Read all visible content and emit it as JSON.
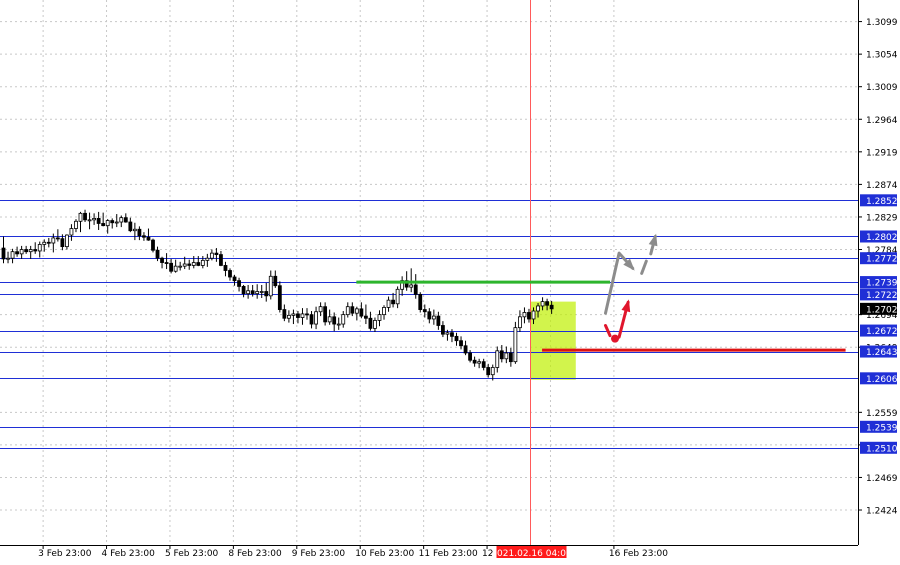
{
  "chart_data": {
    "type": "candlestick",
    "instrument_timeframe": "",
    "price_range": [
      1.2395,
      1.3115
    ],
    "x_categories": [
      "3 Feb 23:00",
      "4 Feb 23:00",
      "5 Feb 23:00",
      "8 Feb 23:00",
      "9 Feb 23:00",
      "10 Feb 23:00",
      "11 Feb 23:00",
      "12 Feb 23:00",
      "2021.02.16 04:00",
      "16 Feb 23:00"
    ],
    "x_bar_index": [
      4,
      18,
      32,
      46,
      60,
      74,
      88,
      102,
      116,
      130
    ],
    "y_ticks": [
      "1.3099",
      "1.3054",
      "1.3009",
      "1.2964",
      "1.2919",
      "1.2874",
      "1.2829",
      "1.2784",
      "1.2694",
      "1.2649",
      "1.2559",
      "1.2514",
      "1.2469",
      "1.2424"
    ],
    "y_tick_values": [
      1.3099,
      1.3054,
      1.3009,
      1.2964,
      1.2919,
      1.2874,
      1.2829,
      1.2784,
      1.2694,
      1.2649,
      1.2559,
      1.2514,
      1.2469,
      1.2424
    ],
    "current_price": "1.2702",
    "current_price_value": 1.2702,
    "levels": [
      {
        "label": "1.2852",
        "value": 1.2852
      },
      {
        "label": "1.2802",
        "value": 1.2802
      },
      {
        "label": "1.2772",
        "value": 1.2772
      },
      {
        "label": "1.2739",
        "value": 1.2739
      },
      {
        "label": "1.2722",
        "value": 1.2722
      },
      {
        "label": "1.2672",
        "value": 1.2672
      },
      {
        "label": "1.2643",
        "value": 1.2643
      },
      {
        "label": "1.2606",
        "value": 1.2606
      },
      {
        "label": "1.2539",
        "value": 1.2539
      },
      {
        "label": "1.2510",
        "value": 1.251
      }
    ],
    "vertical_marker": {
      "label": "2021.02.16 04:00",
      "bar_index": 116
    },
    "highlight_zone": {
      "bar_start": 116,
      "bar_end": 126,
      "price_low": 1.2604,
      "price_high": 1.2712,
      "color": "#bff000"
    },
    "green_level": {
      "value": 1.2739,
      "bar_start": 78,
      "bar_end": 134,
      "color": "#2db52d"
    },
    "red_level": {
      "value": 1.2645,
      "bar_start": 119,
      "bar_end": 186,
      "color": "#dd1111"
    },
    "projections": [
      {
        "color": "#8c8c8c",
        "points": [
          [
            133,
            1.2696
          ],
          [
            136,
            1.2779
          ],
          [
            139,
            1.2758
          ]
        ]
      },
      {
        "color": "#8c8c8c",
        "points": [
          [
            141,
            1.2751
          ],
          [
            142,
            1.2768
          ]
        ]
      },
      {
        "color": "#8c8c8c",
        "points": [
          [
            143,
            1.2778
          ],
          [
            144,
            1.2802
          ]
        ]
      },
      {
        "color": "#e0162c",
        "points": [
          [
            133,
            1.2679
          ],
          [
            134,
            1.2665
          ]
        ]
      },
      {
        "color": "#e0162c",
        "points": [
          [
            136,
            1.2663
          ],
          [
            138,
            1.2711
          ]
        ]
      }
    ],
    "candles": [
      [
        1.2786,
        1.2802,
        1.2765,
        1.2771
      ],
      [
        1.2771,
        1.2781,
        1.2765,
        1.2772
      ],
      [
        1.2772,
        1.2785,
        1.2765,
        1.2781
      ],
      [
        1.2781,
        1.2788,
        1.2774,
        1.2778
      ],
      [
        1.2778,
        1.2789,
        1.2771,
        1.2784
      ],
      [
        1.2784,
        1.2789,
        1.2778,
        1.2781
      ],
      [
        1.2781,
        1.2789,
        1.2771,
        1.2784
      ],
      [
        1.2784,
        1.2794,
        1.2778,
        1.2782
      ],
      [
        1.2782,
        1.2795,
        1.2773,
        1.2791
      ],
      [
        1.2791,
        1.2798,
        1.2781,
        1.2794
      ],
      [
        1.2794,
        1.28,
        1.2787,
        1.2793
      ],
      [
        1.2793,
        1.2806,
        1.278,
        1.28
      ],
      [
        1.28,
        1.2812,
        1.2795,
        1.2799
      ],
      [
        1.2799,
        1.2805,
        1.2783,
        1.2788
      ],
      [
        1.2788,
        1.2805,
        1.2784,
        1.2804
      ],
      [
        1.2804,
        1.2819,
        1.2796,
        1.2813
      ],
      [
        1.2813,
        1.2826,
        1.2808,
        1.2823
      ],
      [
        1.2823,
        1.2836,
        1.2808,
        1.2834
      ],
      [
        1.2834,
        1.2839,
        1.2822,
        1.2825
      ],
      [
        1.2825,
        1.2835,
        1.2812,
        1.2825
      ],
      [
        1.2825,
        1.2834,
        1.2818,
        1.2827
      ],
      [
        1.2827,
        1.2836,
        1.2811,
        1.282
      ],
      [
        1.282,
        1.2835,
        1.2816,
        1.2817
      ],
      [
        1.2817,
        1.2826,
        1.2806,
        1.2824
      ],
      [
        1.2824,
        1.2827,
        1.2813,
        1.2821
      ],
      [
        1.2821,
        1.2833,
        1.2815,
        1.2822
      ],
      [
        1.2822,
        1.2831,
        1.2815,
        1.2828
      ],
      [
        1.2828,
        1.2834,
        1.2821,
        1.2822
      ],
      [
        1.2822,
        1.2828,
        1.2808,
        1.281
      ],
      [
        1.281,
        1.2821,
        1.2797,
        1.2812
      ],
      [
        1.2812,
        1.2816,
        1.2797,
        1.2803
      ],
      [
        1.2803,
        1.2808,
        1.2796,
        1.2801
      ],
      [
        1.2801,
        1.2813,
        1.2796,
        1.2797
      ],
      [
        1.2797,
        1.2799,
        1.278,
        1.2783
      ],
      [
        1.2783,
        1.2788,
        1.2768,
        1.2772
      ],
      [
        1.2772,
        1.2774,
        1.2758,
        1.2766
      ],
      [
        1.2766,
        1.2779,
        1.2757,
        1.2765
      ],
      [
        1.2765,
        1.2771,
        1.2751,
        1.2754
      ],
      [
        1.2754,
        1.277,
        1.2752,
        1.2761
      ],
      [
        1.2761,
        1.2767,
        1.2755,
        1.2761
      ],
      [
        1.2761,
        1.2774,
        1.2757,
        1.2764
      ],
      [
        1.2764,
        1.277,
        1.2756,
        1.2762
      ],
      [
        1.2762,
        1.2775,
        1.2758,
        1.2766
      ],
      [
        1.2766,
        1.2775,
        1.2761,
        1.2762
      ],
      [
        1.2762,
        1.2775,
        1.2758,
        1.2769
      ],
      [
        1.2769,
        1.2778,
        1.276,
        1.2772
      ],
      [
        1.2772,
        1.2784,
        1.2769,
        1.2779
      ],
      [
        1.2779,
        1.2786,
        1.2767,
        1.2777
      ],
      [
        1.2777,
        1.2782,
        1.2761,
        1.2762
      ],
      [
        1.2762,
        1.2767,
        1.2747,
        1.2755
      ],
      [
        1.2755,
        1.2758,
        1.2741,
        1.2746
      ],
      [
        1.2746,
        1.2749,
        1.2734,
        1.2741
      ],
      [
        1.2741,
        1.2745,
        1.2726,
        1.2733
      ],
      [
        1.2733,
        1.2735,
        1.2718,
        1.2723
      ],
      [
        1.2723,
        1.2735,
        1.2716,
        1.2727
      ],
      [
        1.2727,
        1.2735,
        1.2719,
        1.2723
      ],
      [
        1.2723,
        1.2736,
        1.2716,
        1.2726
      ],
      [
        1.2726,
        1.2735,
        1.2717,
        1.2726
      ],
      [
        1.2726,
        1.2738,
        1.2712,
        1.272
      ],
      [
        1.272,
        1.2755,
        1.2715,
        1.2747
      ],
      [
        1.2747,
        1.2755,
        1.2731,
        1.2734
      ],
      [
        1.2734,
        1.274,
        1.2697,
        1.2701
      ],
      [
        1.2701,
        1.2708,
        1.2685,
        1.2689
      ],
      [
        1.2689,
        1.27,
        1.2683,
        1.2693
      ],
      [
        1.2693,
        1.2701,
        1.2681,
        1.2695
      ],
      [
        1.2695,
        1.2699,
        1.2682,
        1.269
      ],
      [
        1.269,
        1.2703,
        1.268,
        1.2695
      ],
      [
        1.2695,
        1.2703,
        1.2687,
        1.2694
      ],
      [
        1.2694,
        1.2699,
        1.2675,
        1.2681
      ],
      [
        1.2681,
        1.2705,
        1.2674,
        1.2698
      ],
      [
        1.2698,
        1.2711,
        1.2692,
        1.2705
      ],
      [
        1.2705,
        1.2711,
        1.2679,
        1.2684
      ],
      [
        1.2684,
        1.2701,
        1.268,
        1.2691
      ],
      [
        1.2691,
        1.2697,
        1.2671,
        1.2681
      ],
      [
        1.2681,
        1.269,
        1.2673,
        1.2681
      ],
      [
        1.2681,
        1.2699,
        1.2676,
        1.2694
      ],
      [
        1.2694,
        1.2711,
        1.269,
        1.2705
      ],
      [
        1.2705,
        1.2711,
        1.2692,
        1.2696
      ],
      [
        1.2696,
        1.2705,
        1.2686,
        1.2702
      ],
      [
        1.2702,
        1.2711,
        1.2689,
        1.2692
      ],
      [
        1.2692,
        1.2708,
        1.2681,
        1.2689
      ],
      [
        1.2689,
        1.2698,
        1.2672,
        1.2675
      ],
      [
        1.2675,
        1.269,
        1.267,
        1.2686
      ],
      [
        1.2686,
        1.27,
        1.2678,
        1.2694
      ],
      [
        1.2694,
        1.2707,
        1.2687,
        1.2704
      ],
      [
        1.2704,
        1.2719,
        1.2698,
        1.2714
      ],
      [
        1.2714,
        1.2724,
        1.2704,
        1.2709
      ],
      [
        1.2709,
        1.2733,
        1.2703,
        1.2729
      ],
      [
        1.2729,
        1.2747,
        1.272,
        1.2741
      ],
      [
        1.2741,
        1.2754,
        1.2727,
        1.2732
      ],
      [
        1.2732,
        1.2758,
        1.2725,
        1.2735
      ],
      [
        1.2735,
        1.275,
        1.2716,
        1.2722
      ],
      [
        1.2722,
        1.2725,
        1.2697,
        1.2701
      ],
      [
        1.2701,
        1.2708,
        1.269,
        1.2698
      ],
      [
        1.2698,
        1.2703,
        1.2682,
        1.2688
      ],
      [
        1.2688,
        1.2701,
        1.268,
        1.2692
      ],
      [
        1.2692,
        1.2698,
        1.2673,
        1.2679
      ],
      [
        1.2679,
        1.2685,
        1.2663,
        1.2667
      ],
      [
        1.2667,
        1.2673,
        1.2658,
        1.2669
      ],
      [
        1.2669,
        1.2674,
        1.2656,
        1.2664
      ],
      [
        1.2664,
        1.2669,
        1.2651,
        1.2658
      ],
      [
        1.2658,
        1.2664,
        1.2646,
        1.2651
      ],
      [
        1.2651,
        1.2658,
        1.2638,
        1.2641
      ],
      [
        1.2641,
        1.2645,
        1.2628,
        1.2631
      ],
      [
        1.2631,
        1.2636,
        1.2622,
        1.2627
      ],
      [
        1.2627,
        1.2633,
        1.262,
        1.2629
      ],
      [
        1.2629,
        1.2633,
        1.2617,
        1.2621
      ],
      [
        1.2621,
        1.2626,
        1.2607,
        1.2611
      ],
      [
        1.2611,
        1.2625,
        1.2603,
        1.2621
      ],
      [
        1.2621,
        1.265,
        1.2614,
        1.2644
      ],
      [
        1.2644,
        1.2652,
        1.2628,
        1.2633
      ],
      [
        1.2633,
        1.265,
        1.2627,
        1.2641
      ],
      [
        1.2641,
        1.2648,
        1.2622,
        1.2629
      ],
      [
        1.2629,
        1.2684,
        1.2626,
        1.2676
      ],
      [
        1.2676,
        1.27,
        1.267,
        1.2691
      ],
      [
        1.2691,
        1.2704,
        1.2682,
        1.2697
      ],
      [
        1.2697,
        1.2702,
        1.2683,
        1.2688
      ],
      [
        1.2688,
        1.2704,
        1.2681,
        1.2699
      ],
      [
        1.2699,
        1.271,
        1.269,
        1.2706
      ],
      [
        1.2706,
        1.2718,
        1.27,
        1.2712
      ],
      [
        1.2712,
        1.2716,
        1.27,
        1.2707
      ],
      [
        1.2707,
        1.2713,
        1.2695,
        1.2702
      ]
    ]
  }
}
